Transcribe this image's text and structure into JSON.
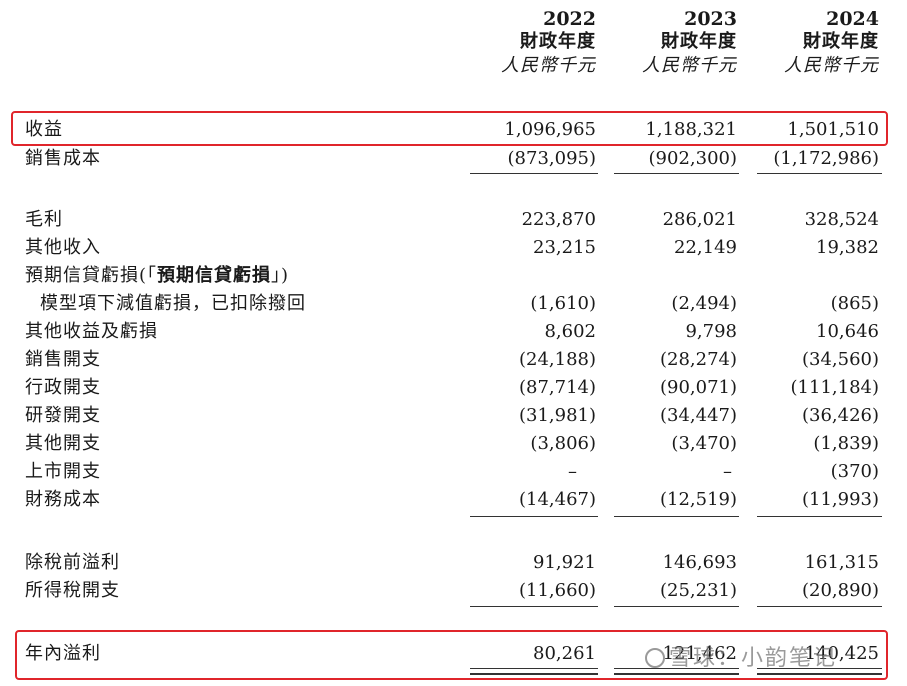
{
  "header": {
    "years": [
      "2022",
      "2023",
      "2024"
    ],
    "fiscal_year_label": "財政年度",
    "currency_label": "人民幣千元"
  },
  "rows": [
    {
      "label": "收益",
      "values": [
        "1,096,965",
        "1,188,321",
        "1,501,510"
      ]
    },
    {
      "label": "銷售成本",
      "values": [
        "(873,095)",
        "(902,300)",
        "(1,172,986)"
      ]
    },
    {
      "label": "毛利",
      "values": [
        "223,870",
        "286,021",
        "328,524"
      ]
    },
    {
      "label": "其他收入",
      "values": [
        "23,215",
        "22,149",
        "19,382"
      ]
    },
    {
      "label_prefix": "預期信貸虧損(「",
      "label_bold": "預期信貸虧損",
      "label_suffix": "」)"
    },
    {
      "label": "模型項下減值虧損，已扣除撥回",
      "values": [
        "(1,610)",
        "(2,494)",
        "(865)"
      ]
    },
    {
      "label": "其他收益及虧損",
      "values": [
        "8,602",
        "9,798",
        "10,646"
      ]
    },
    {
      "label": "銷售開支",
      "values": [
        "(24,188)",
        "(28,274)",
        "(34,560)"
      ]
    },
    {
      "label": "行政開支",
      "values": [
        "(87,714)",
        "(90,071)",
        "(111,184)"
      ]
    },
    {
      "label": "研發開支",
      "values": [
        "(31,981)",
        "(34,447)",
        "(36,426)"
      ]
    },
    {
      "label": "其他開支",
      "values": [
        "(3,806)",
        "(3,470)",
        "(1,839)"
      ]
    },
    {
      "label": "上市開支",
      "values": [
        "–",
        "–",
        "(370)"
      ]
    },
    {
      "label": "財務成本",
      "values": [
        "(14,467)",
        "(12,519)",
        "(11,993)"
      ]
    },
    {
      "label": "除稅前溢利",
      "values": [
        "91,921",
        "146,693",
        "161,315"
      ]
    },
    {
      "label": "所得稅開支",
      "values": [
        "(11,660)",
        "(25,231)",
        "(20,890)"
      ]
    },
    {
      "label": "年內溢利",
      "values": [
        "80,261",
        "121,462",
        "140,425"
      ]
    }
  ],
  "highlight_color": "#e0252b",
  "watermark": {
    "text": "雪球：小韵笔记",
    "icon": "snowball-icon"
  }
}
